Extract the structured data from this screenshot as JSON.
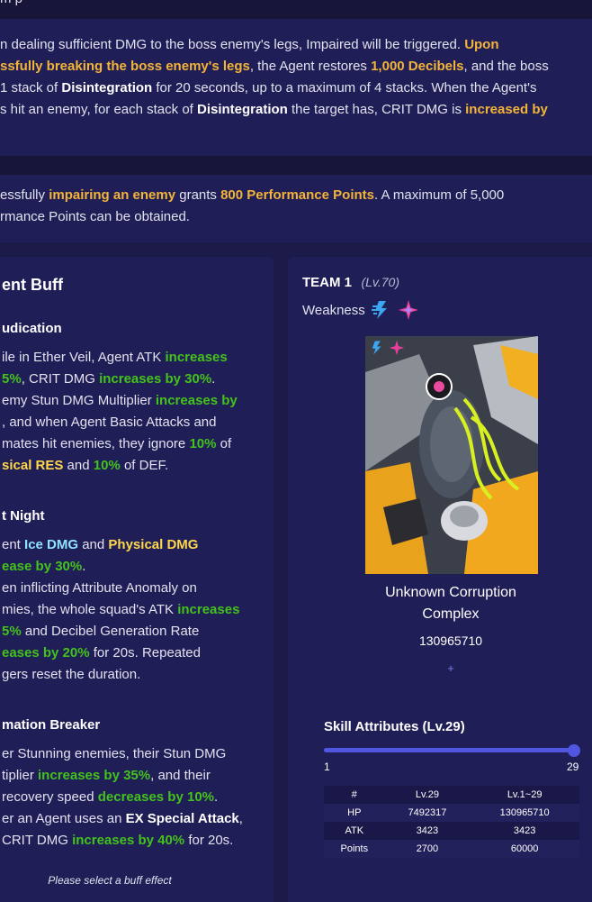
{
  "top_fragment": "m p",
  "boss_mechanic": {
    "line1": {
      "a": "n dealing sufficient DMG to the boss enemy's legs, Impaired will be triggered. ",
      "b": "Upon"
    },
    "line2": {
      "a": "ssfully breaking the boss enemy's legs",
      "b": ", the Agent restores ",
      "c": "1,000 Decibels",
      "d": ", and the boss"
    },
    "line3": {
      "a": "1 stack of ",
      "b": "Disintegration",
      "c": " for 20 seconds, up to a maximum of 4 stacks. When the Agent's"
    },
    "line4": {
      "a": "s hit an enemy, for each stack of ",
      "b": "Disintegration",
      "c": " the target has, CRIT DMG is ",
      "d": "increased by"
    }
  },
  "performance": {
    "line1": {
      "a": "essfully ",
      "b": "impairing an enemy",
      "c": " grants ",
      "d": "800 Performance Points",
      "e": ". A maximum of 5,000"
    },
    "line2": "rmance Points can be obtained."
  },
  "agent_buff": {
    "title": "ent Buff",
    "buffs": [
      {
        "name": "udication",
        "l1a": "ile in Ether Veil, Agent ATK ",
        "l1b": "increases",
        "l2a": "5%",
        "l2b": ", CRIT DMG ",
        "l2c": "increases by 30%",
        "l2d": ".",
        "l3a": "emy Stun DMG Multiplier ",
        "l3b": "increases by",
        "l4": ", and when Agent Basic Attacks and",
        "l5a": "mates hit enemies, they ignore ",
        "l5b": "10%",
        "l5c": " of",
        "l6a": "sical RES",
        "l6b": " and ",
        "l6c": "10%",
        "l6d": " of DEF."
      },
      {
        "name": "t Night",
        "l1a": "ent ",
        "l1b": "Ice DMG",
        "l1c": " and ",
        "l1d": "Physical DMG",
        "l2": "ease by 30%",
        "l2b": ".",
        "l3": "en inflicting Attribute Anomaly on",
        "l4a": "mies, the whole squad's ATK ",
        "l4b": "increases",
        "l5a": "5%",
        "l5b": " and Decibel Generation Rate",
        "l6a": "eases by 20%",
        "l6b": " for 20s. Repeated",
        "l7": "gers reset the duration."
      },
      {
        "name": "mation Breaker",
        "l1": "er Stunning enemies, their Stun DMG",
        "l2a": "tiplier ",
        "l2b": "increases by 35%",
        "l2c": ", and their",
        "l3a": " recovery speed ",
        "l3b": "decreases by 10%",
        "l3c": ".",
        "l4a": "er an Agent uses an ",
        "l4b": "EX Special Attack",
        "l4c": ",",
        "l5a": " CRIT DMG ",
        "l5b": "increases by 40%",
        "l5c": " for 20s."
      }
    ],
    "hint": "Please select a buff effect"
  },
  "team": {
    "label": "TEAM 1",
    "level": "(Lv.70)",
    "weakness_label": "Weakness",
    "weakness_icons": [
      "electric-icon",
      "ether-icon"
    ],
    "boss_name_line1": "Unknown Corruption",
    "boss_name_line2": "Complex",
    "boss_hp": "130965710",
    "expand_symbol": "+"
  },
  "skill_attributes": {
    "title": "Skill Attributes (Lv.29)",
    "level_min": "1",
    "level_max": "29",
    "level_current": 29,
    "table": {
      "headers": [
        "#",
        "Lv.29",
        "Lv.1~29"
      ],
      "rows": [
        [
          "HP",
          "7492317",
          "130965710"
        ],
        [
          "ATK",
          "3423",
          "3423"
        ],
        [
          "Points",
          "2700",
          "60000"
        ]
      ]
    }
  },
  "colors": {
    "page_bg": "#1c1a48",
    "panel_bg": "#201e56",
    "accent_orange": "#f3b43a",
    "accent_green": "#43c21c",
    "slider_blue": "#5156e0"
  }
}
